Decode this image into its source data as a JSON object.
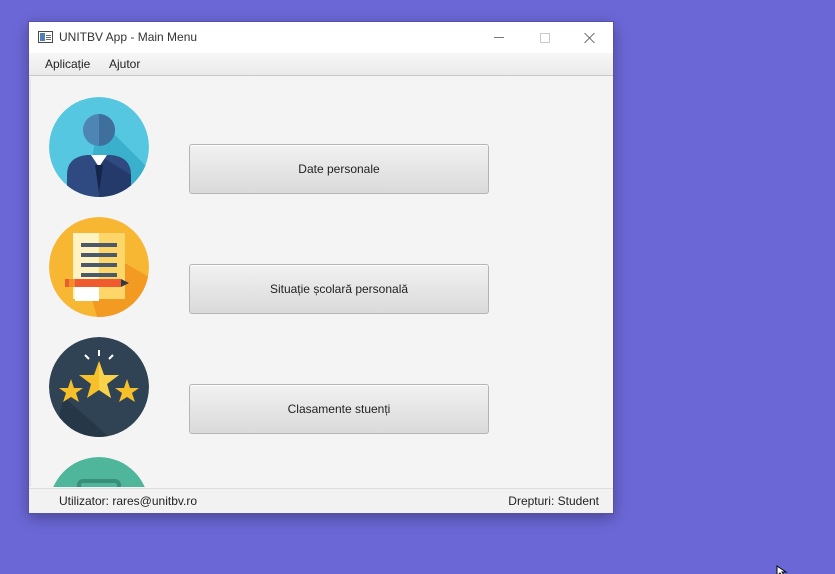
{
  "window": {
    "title": "UNITBV App - Main Menu"
  },
  "menu": {
    "items": [
      "Aplicație",
      "Ajutor"
    ]
  },
  "main": {
    "items": [
      {
        "label": "Date personale",
        "icon": "user-profile-icon"
      },
      {
        "label": "Situație școlară personală",
        "icon": "document-grades-icon"
      },
      {
        "label": "Clasamente stuenți",
        "icon": "stars-ranking-icon"
      },
      {
        "label": "",
        "icon": "partial-teal-icon"
      }
    ]
  },
  "status": {
    "user": "Utilizator: rares@unitbv.ro",
    "rights": "Drepturi: Student"
  },
  "colors": {
    "desktop": "#6b67d6",
    "window_bg": "#f4f4f4",
    "icon_user_bg": "#55c7e0",
    "icon_doc_bg": "#f7b733",
    "icon_stars_bg": "#2f4354",
    "icon_teal_bg": "#4fb59b"
  }
}
